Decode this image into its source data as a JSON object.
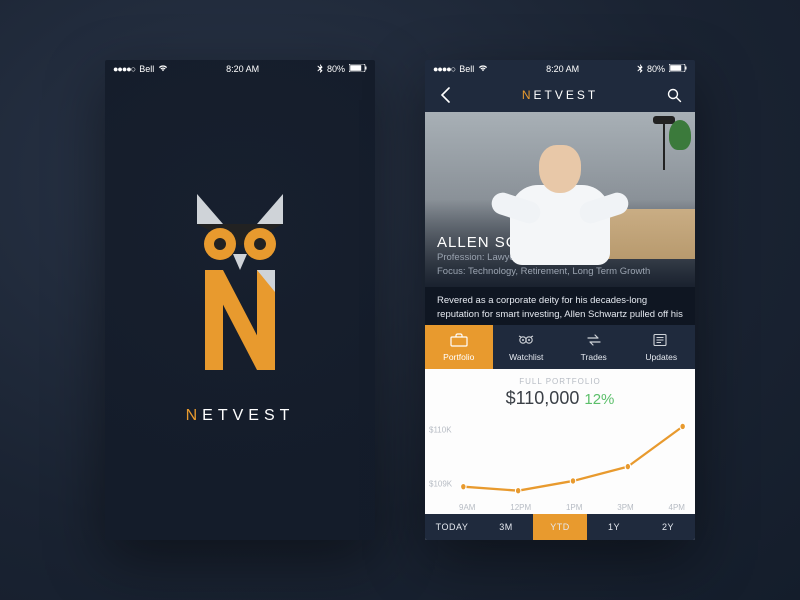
{
  "colors": {
    "accent": "#e89a2e",
    "bg_dark": "#1f2a3d",
    "positive": "#5bbf6a"
  },
  "status": {
    "carrier": "Bell",
    "time": "8:20 AM",
    "battery": "80%"
  },
  "brand": {
    "pre": "N",
    "mid": "ET",
    "post": "VEST"
  },
  "nav": {
    "title_pre": "N",
    "title_mid": "ET",
    "title_post": "VEST"
  },
  "profile": {
    "name": "ALLEN SCHWARTZ",
    "profession_label": "Profession:",
    "profession_value": "Lawyer",
    "focus_label": "Focus:",
    "focus_value": "Technology, Retirement, Long Term Growth",
    "bio": "Revered as a corporate deity for his decades-long reputation for smart investing, Allen Schwartz pulled off his biggest deal ever in August, when his Hathaway"
  },
  "tabs": [
    {
      "label": "Portfolio",
      "active": true
    },
    {
      "label": "Watchlist",
      "active": false
    },
    {
      "label": "Trades",
      "active": false
    },
    {
      "label": "Updates",
      "active": false
    }
  ],
  "portfolio": {
    "label": "FULL PORTFOLIO",
    "value": "$110,000",
    "pct": "12%"
  },
  "chart_data": {
    "type": "line",
    "title": "FULL PORTFOLIO",
    "ylabel": "",
    "xlabel": "",
    "y_ticks": [
      "$110K",
      "$109K"
    ],
    "ylim": [
      109000,
      110300
    ],
    "x": [
      "9AM",
      "12PM",
      "1PM",
      "3PM",
      "4PM"
    ],
    "values": [
      109150,
      109080,
      109250,
      109500,
      110200
    ]
  },
  "timeframes": [
    {
      "label": "TODAY",
      "active": false
    },
    {
      "label": "3M",
      "active": false
    },
    {
      "label": "YTD",
      "active": true
    },
    {
      "label": "1Y",
      "active": false
    },
    {
      "label": "2Y",
      "active": false
    }
  ]
}
